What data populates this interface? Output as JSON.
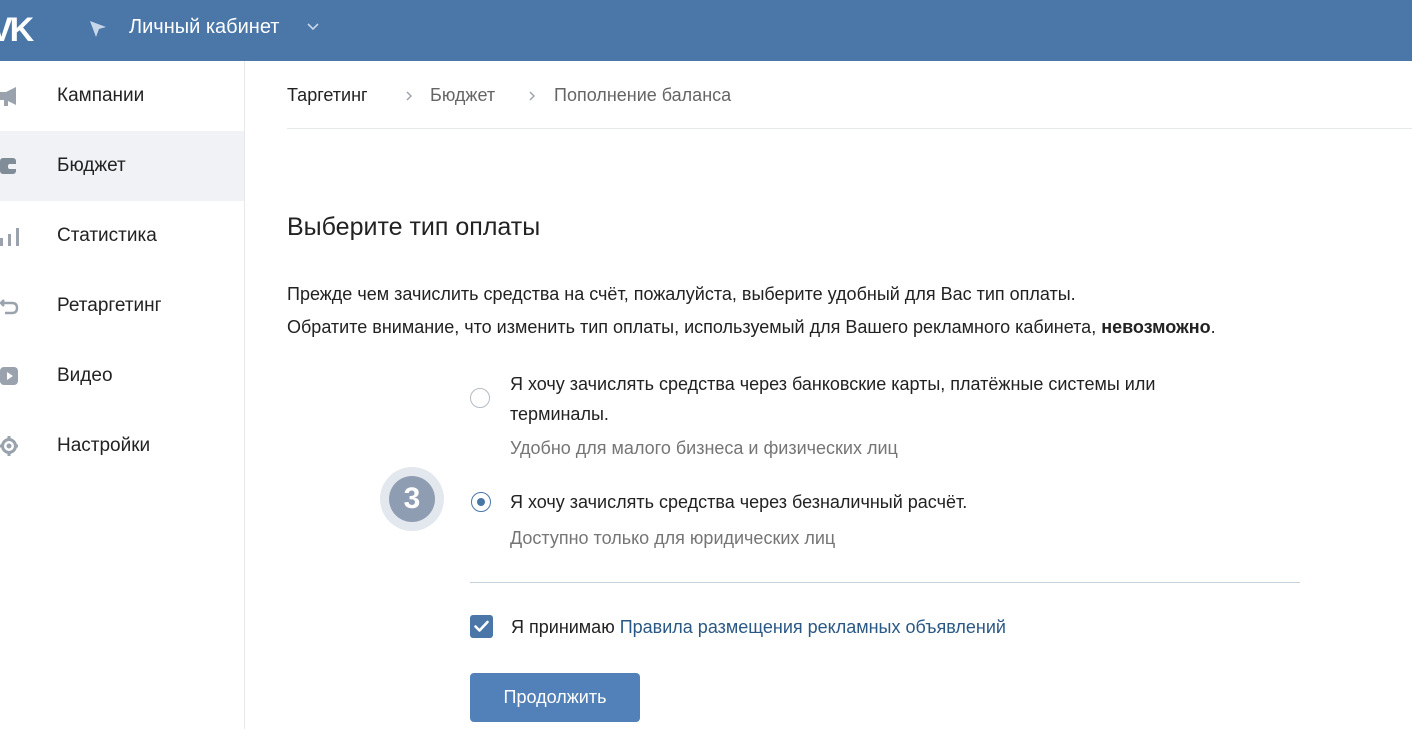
{
  "header": {
    "logo": "VK",
    "title": "Личный кабинет"
  },
  "sidebar": {
    "items": [
      {
        "label": "Кампании",
        "icon": "megaphone-icon"
      },
      {
        "label": "Бюджет",
        "icon": "wallet-icon",
        "active": true
      },
      {
        "label": "Статистика",
        "icon": "bar-chart-icon"
      },
      {
        "label": "Ретаргетинг",
        "icon": "return-arrow-icon"
      },
      {
        "label": "Видео",
        "icon": "video-icon"
      },
      {
        "label": "Настройки",
        "icon": "gear-icon"
      }
    ]
  },
  "breadcrumb": {
    "items": [
      "Таргетинг",
      "Бюджет",
      "Пополнение баланса"
    ]
  },
  "main": {
    "heading": "Выберите тип оплаты",
    "intro_line1": "Прежде чем зачислить средства на счёт, пожалуйста, выберите удобный для Вас тип оплаты.",
    "intro_line2_prefix": "Обратите внимание, что изменить тип оплаты, используемый для Вашего рекламного кабинета, ",
    "intro_line2_bold": "невозможно",
    "intro_line2_suffix": ".",
    "options": [
      {
        "title_line1": "Я хочу зачислять средства через банковские карты, платёжные системы или",
        "title_line2": "терминалы.",
        "hint": "Удобно для малого бизнеса и физических лиц",
        "selected": false
      },
      {
        "title_line1": "Я хочу зачислять средства через безналичный расчёт.",
        "hint": "Доступно только для юридических лиц",
        "selected": true
      }
    ],
    "step_badge": "3",
    "accept_prefix": "Я принимаю",
    "accept_link": "Правила размещения рекламных объявлений",
    "accept_checked": true,
    "continue_label": "Продолжить"
  },
  "colors": {
    "header_bg": "#4a76a8",
    "accent": "#5181b8",
    "link": "#2a5885",
    "sidebar_active_bg": "#f0f2f5"
  }
}
